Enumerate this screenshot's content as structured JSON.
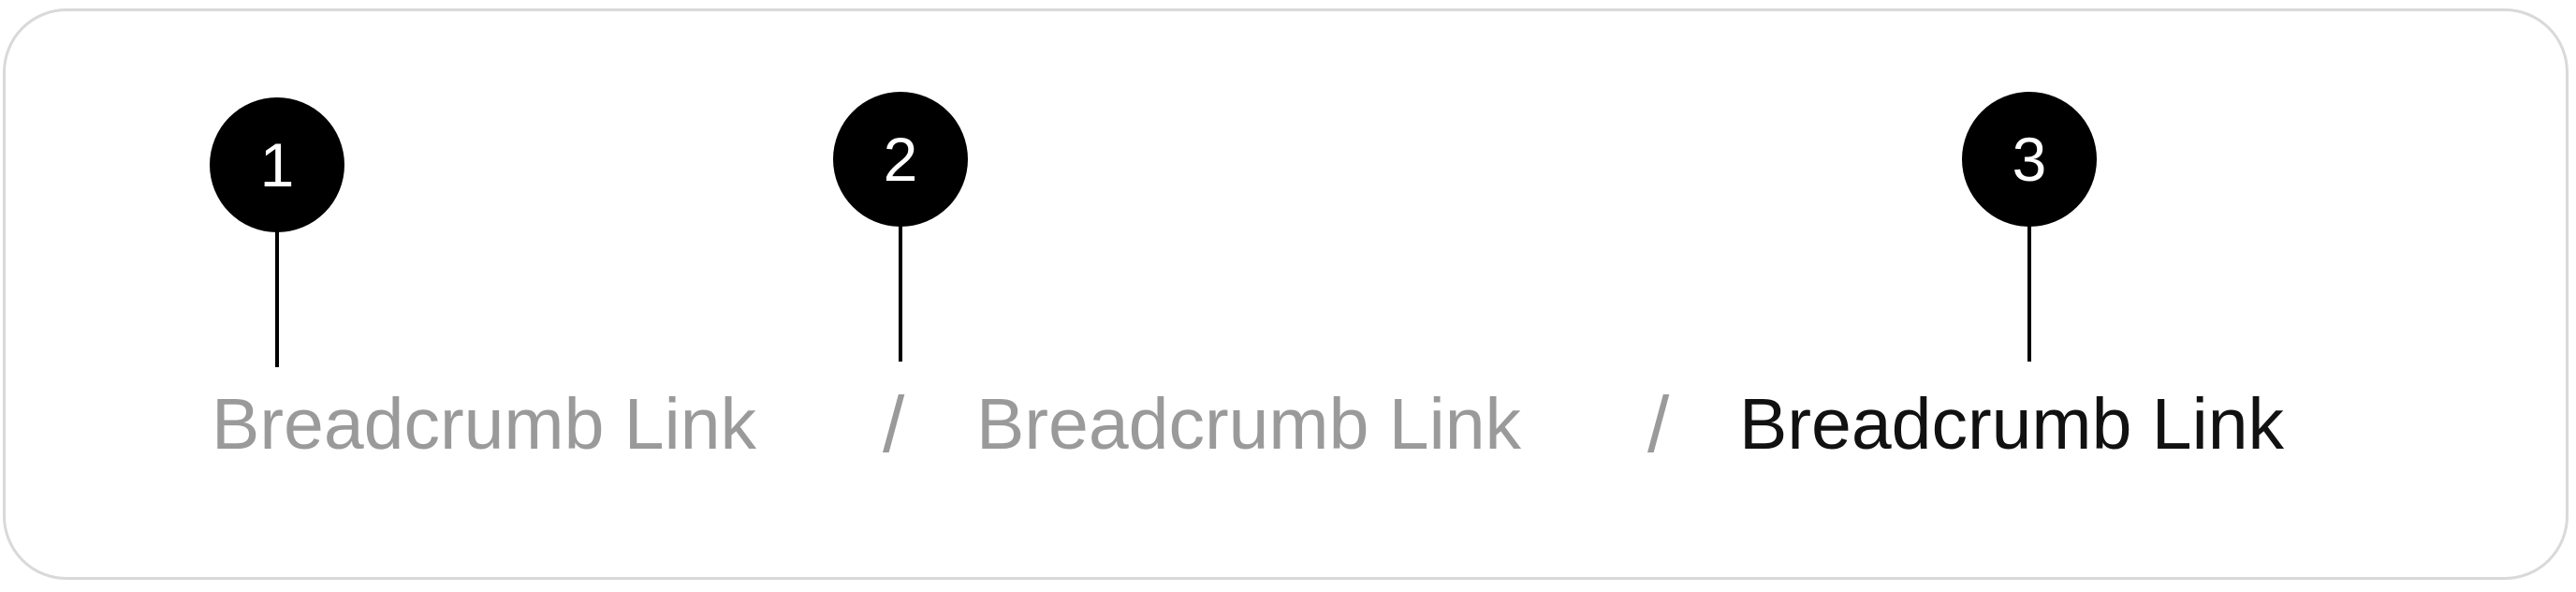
{
  "breadcrumb": {
    "items": [
      {
        "label": "Breadcrumb Link",
        "state": "link"
      },
      {
        "label": "Breadcrumb Link",
        "state": "link"
      },
      {
        "label": "Breadcrumb Link",
        "state": "current"
      }
    ],
    "separator": "/"
  },
  "annotations": [
    {
      "number": "1"
    },
    {
      "number": "2"
    },
    {
      "number": "3"
    }
  ],
  "colors": {
    "link_text": "#9a9a9a",
    "current_text": "#111111",
    "marker_fill": "#000000",
    "frame_border": "#d9d9d9"
  }
}
